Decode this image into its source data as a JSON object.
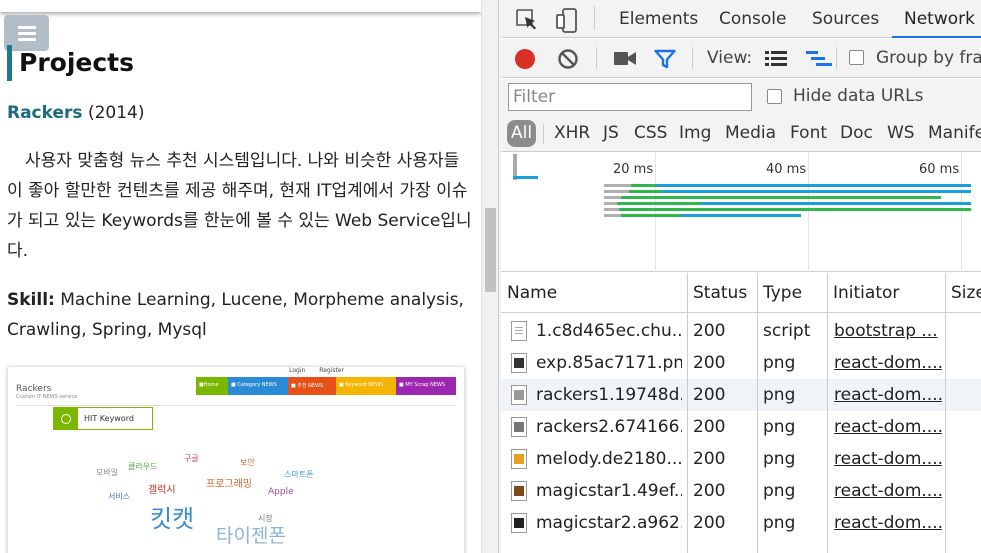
{
  "page": {
    "title": "Projects",
    "project_link": "Rackers",
    "project_year": "(2014)",
    "description": "사용자 맞춤형 뉴스 추천 시스템입니다. 나와 비슷한 사용자들이 좋아 할만한 컨텐츠를 제공 해주며, 현재 IT업계에서 가장 이슈가 되고 있는 Keywords를 한눈에 볼 수 있는 Web Service입니다.",
    "skill_label": "Skill:",
    "skill_value": " Machine Learning, Lucene, Morpheme analysis, Crawling, Spring, Mysql"
  },
  "thumbnail": {
    "brand": "Rackers",
    "subtitle": "Custom IT NEWS service",
    "top_links": [
      "Login",
      "Register"
    ],
    "nav": [
      {
        "label": "■Home",
        "color": "#7ab800"
      },
      {
        "label": "■ Category NEWS",
        "color": "#2b8ad6"
      },
      {
        "label": "■ 추천 NEWS",
        "color": "#e8501a"
      },
      {
        "label": "■ Keyword NEWS",
        "color": "#f4b400"
      },
      {
        "label": "■ MY Scrap NEWS",
        "color": "#9c27b0"
      }
    ],
    "hit_label": "HIT Keyword",
    "cloud_words": [
      {
        "text": "킷캣",
        "color": "#3a8bd0"
      },
      {
        "text": "타이젠폰",
        "color": "#8fb4d8"
      },
      {
        "text": "프로그래밍",
        "color": "#e06020"
      },
      {
        "text": "갤럭시",
        "color": "#c03030"
      },
      {
        "text": "클라우드",
        "color": "#5aa050"
      },
      {
        "text": "보안",
        "color": "#c07030"
      },
      {
        "text": "모바일",
        "color": "#888"
      },
      {
        "text": "Apple",
        "color": "#a05090"
      },
      {
        "text": "서비스",
        "color": "#3a7fb0"
      },
      {
        "text": "스마트폰",
        "color": "#4a9ad0"
      },
      {
        "text": "구글",
        "color": "#d04040"
      },
      {
        "text": "시장",
        "color": "#777"
      }
    ]
  },
  "devtools": {
    "tabs": [
      "Elements",
      "Console",
      "Sources",
      "Network"
    ],
    "active_tab": "Network",
    "toolbar": {
      "view_label": "View:",
      "group_label": "Group by frame"
    },
    "filter_placeholder": "Filter",
    "hide_data_urls": "Hide data URLs",
    "types": [
      "All",
      "XHR",
      "JS",
      "CSS",
      "Img",
      "Media",
      "Font",
      "Doc",
      "WS",
      "Manifest"
    ],
    "active_type": "All",
    "timeline_ticks": [
      "20 ms",
      "40 ms",
      "60 ms"
    ],
    "columns": [
      "Name",
      "Status",
      "Type",
      "Initiator",
      "Size"
    ],
    "rows": [
      {
        "name": "1.c8d465ec.chu...",
        "status": "200",
        "type": "script",
        "initiator": "bootstrap ...",
        "icon": "doc",
        "thumb": ""
      },
      {
        "name": "exp.85ac7171.png",
        "status": "200",
        "type": "png",
        "initiator": "react-dom....",
        "icon": "img",
        "thumb": "#333"
      },
      {
        "name": "rackers1.19748d...",
        "status": "200",
        "type": "png",
        "initiator": "react-dom....",
        "icon": "img",
        "thumb": "#999"
      },
      {
        "name": "rackers2.674166...",
        "status": "200",
        "type": "png",
        "initiator": "react-dom....",
        "icon": "img",
        "thumb": "#777"
      },
      {
        "name": "melody.de2180...",
        "status": "200",
        "type": "png",
        "initiator": "react-dom....",
        "icon": "img",
        "thumb": "#e8a020"
      },
      {
        "name": "magicstar1.49ef...",
        "status": "200",
        "type": "png",
        "initiator": "react-dom....",
        "icon": "img",
        "thumb": "#7a4a1a"
      },
      {
        "name": "magicstar2.a962...",
        "status": "200",
        "type": "png",
        "initiator": "react-dom....",
        "icon": "img",
        "thumb": "#222"
      }
    ]
  },
  "colors": {
    "accent": "#1c7a8c",
    "link": "#1a6b80",
    "record": "#d93025",
    "devtools_blue": "#1a73e8"
  }
}
